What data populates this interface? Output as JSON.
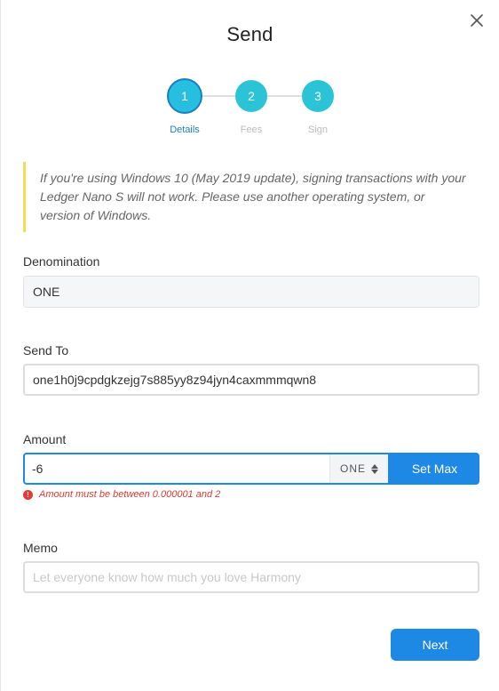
{
  "modal": {
    "title": "Send",
    "close_icon": "close-icon"
  },
  "stepper": {
    "steps": [
      {
        "number": "1",
        "label": "Details",
        "active": true
      },
      {
        "number": "2",
        "label": "Fees",
        "active": false
      },
      {
        "number": "3",
        "label": "Sign",
        "active": false
      }
    ]
  },
  "warning": {
    "text": "If you're using Windows 10 (May 2019 update), signing transactions with your Ledger Nano S will not work. Please use another operating system, or version of Windows."
  },
  "denomination": {
    "label": "Denomination",
    "value": "ONE"
  },
  "send_to": {
    "label": "Send To",
    "value": "one1h0j9cpdgkzejg7s885yy8z94jyn4caxmmmqwn8"
  },
  "amount": {
    "label": "Amount",
    "value": "-6",
    "unit": "ONE",
    "set_max_label": "Set Max",
    "error": "Amount must be between 0.000001 and 2"
  },
  "memo": {
    "label": "Memo",
    "placeholder": "Let everyone know how much you love Harmony"
  },
  "footer": {
    "next_label": "Next"
  },
  "colors": {
    "primary": "#1e88e5",
    "step": "#2bc3d6",
    "error": "#e53935",
    "warning_border": "#f5dd4e"
  }
}
